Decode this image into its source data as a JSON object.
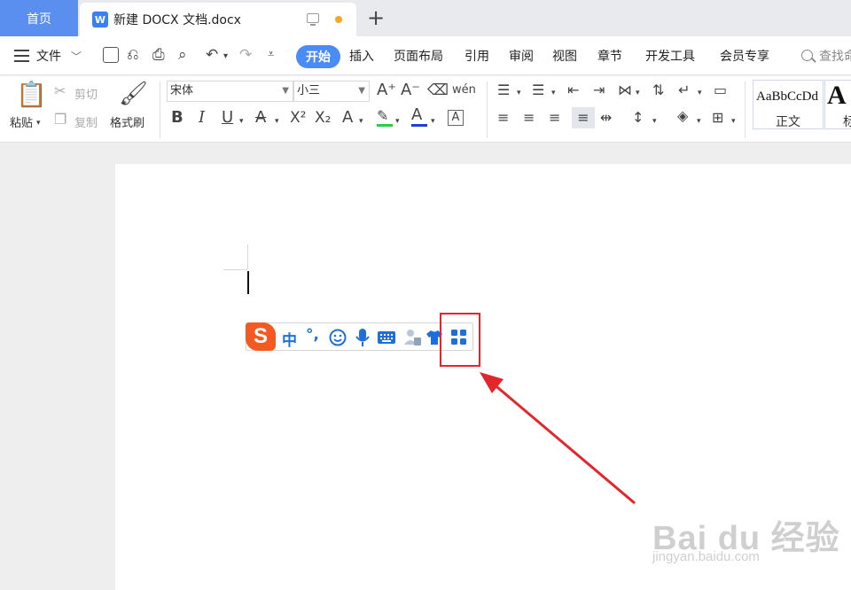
{
  "tabs": {
    "home": "首页",
    "doc_title": "新建 DOCX 文档.docx",
    "doc_icon": "W"
  },
  "menu": {
    "file": "文件",
    "items": [
      "开始",
      "插入",
      "页面布局",
      "引用",
      "审阅",
      "视图",
      "章节",
      "开发工具",
      "会员专享"
    ],
    "search": "查找命"
  },
  "ribbon": {
    "paste": "粘贴",
    "cut": "剪切",
    "copy": "复制",
    "format_painter": "格式刷",
    "font": "宋体",
    "font_size": "小三",
    "style_normal_preview": "AaBbCcDd",
    "style_normal": "正文",
    "style_heading_preview": "A",
    "style_heading": "标"
  },
  "ime": {
    "logo": "S",
    "mode": "中",
    "punct": "°,"
  },
  "watermark": {
    "brand": "Bai du 经验",
    "url": "jingyan.baidu.com"
  },
  "colors": {
    "accent": "#4a8cf5",
    "home_tab": "#5a8ff0",
    "ime_logo": "#f25a22",
    "ime_blue": "#1e6fd9",
    "annotation_red": "#e3262b"
  }
}
